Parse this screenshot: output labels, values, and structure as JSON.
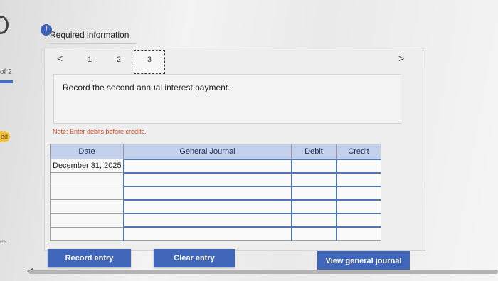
{
  "side": {
    "page_of": "of 2",
    "tag": "ed",
    "bottom": "es"
  },
  "header": {
    "alert_icon": "!",
    "title": "Required information"
  },
  "steps": {
    "prev_icon": "<",
    "next_icon": ">",
    "items": [
      "1",
      "2",
      "3"
    ],
    "active": "3"
  },
  "instruction": "Record the second annual interest payment.",
  "note": "Note: Enter debits before credits.",
  "journal": {
    "columns": [
      "Date",
      "General Journal",
      "Debit",
      "Credit"
    ],
    "rows": [
      {
        "date": "December 31, 2025",
        "account": "",
        "debit": "",
        "credit": ""
      },
      {
        "date": "",
        "account": "",
        "debit": "",
        "credit": ""
      },
      {
        "date": "",
        "account": "",
        "debit": "",
        "credit": ""
      },
      {
        "date": "",
        "account": "",
        "debit": "",
        "credit": ""
      },
      {
        "date": "",
        "account": "",
        "debit": "",
        "credit": ""
      },
      {
        "date": "",
        "account": "",
        "debit": "",
        "credit": ""
      }
    ]
  },
  "buttons": {
    "record": "Record entry",
    "clear": "Clear entry",
    "view": "View general journal"
  },
  "colors": {
    "accent": "#3f66b8",
    "header_bg": "#c3d1ec",
    "note": "#c44a2a"
  }
}
